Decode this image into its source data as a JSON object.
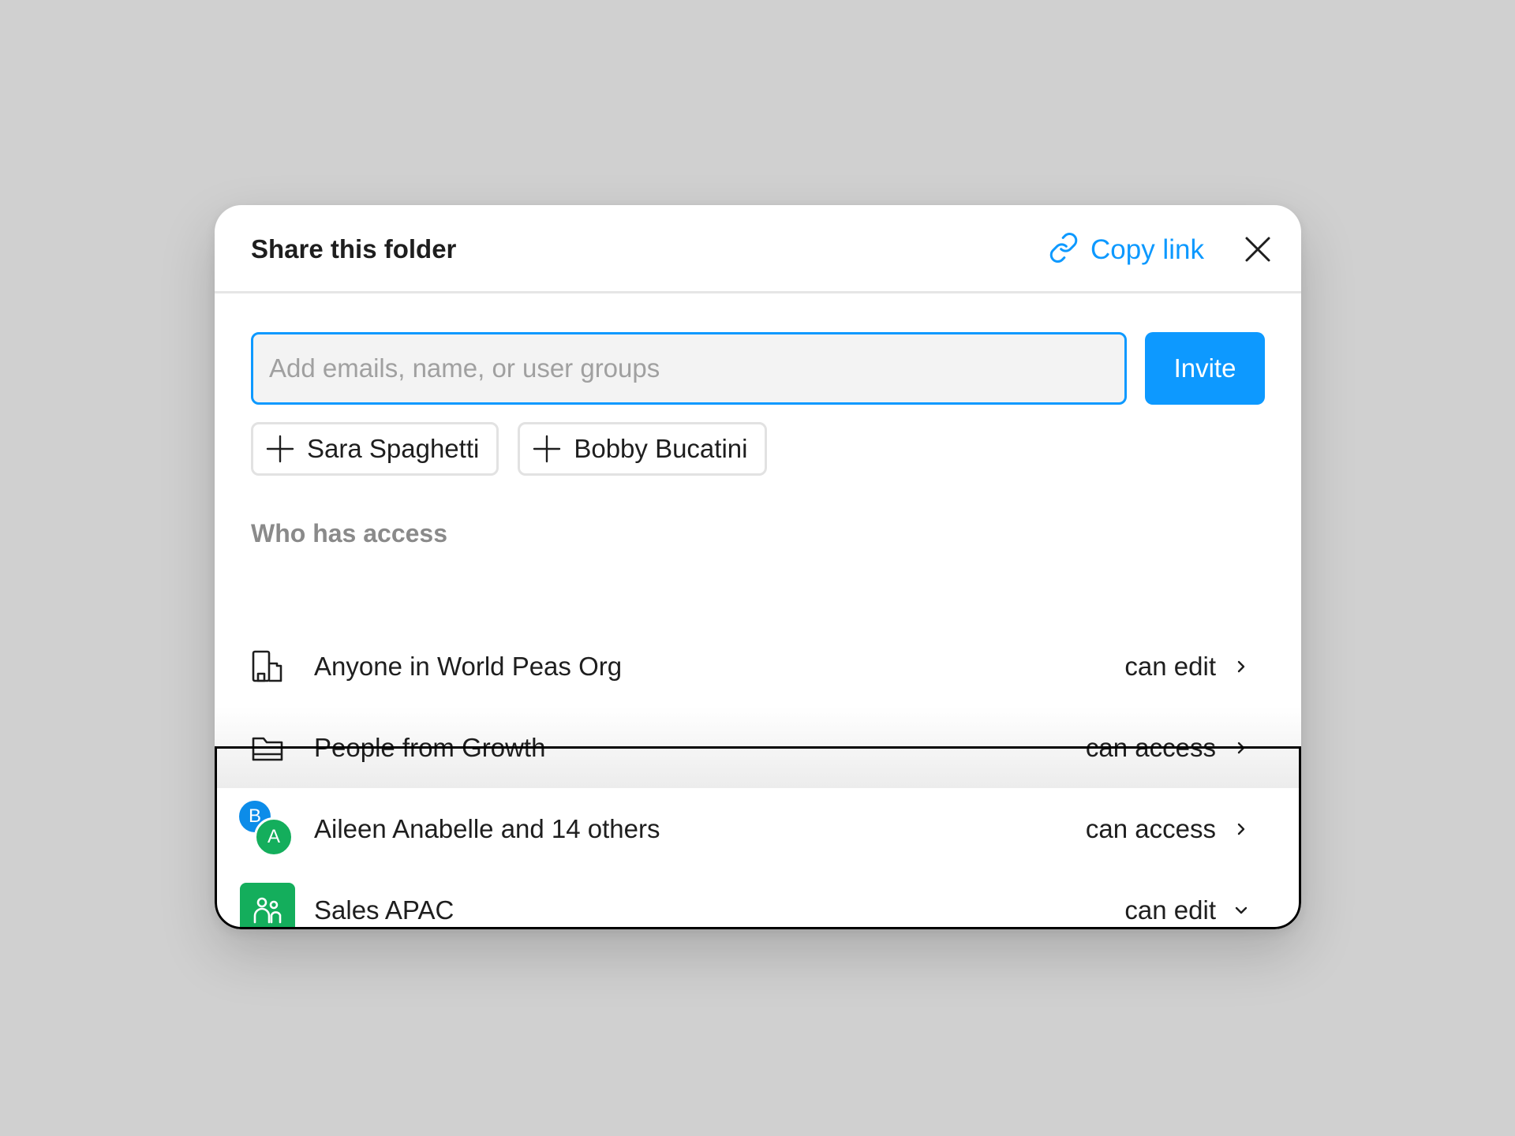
{
  "dialog": {
    "title": "Share this folder",
    "copy_link_label": "Copy link",
    "icons": {
      "copy_link": "link-icon",
      "close": "close-icon"
    }
  },
  "invite": {
    "placeholder": "Add emails, name, or user groups",
    "value": "",
    "button_label": "Invite"
  },
  "suggestions": [
    {
      "label": "Sara Spaghetti",
      "icon": "plus-icon"
    },
    {
      "label": "Bobby Bucatini",
      "icon": "plus-icon"
    }
  ],
  "access": {
    "section_label": "Who has access",
    "rows": [
      {
        "name": "Anyone in World Peas Org",
        "permission": "can edit",
        "icon": "organization-icon",
        "chevron": "chevron-right-icon"
      },
      {
        "name": "People from Growth",
        "permission": "can access",
        "icon": "folder-icon",
        "chevron": "chevron-right-icon"
      },
      {
        "name": "Aileen Anabelle and 14 others",
        "permission": "can access",
        "icon": "avatar-stack",
        "avatars": [
          "B",
          "A"
        ],
        "chevron": "chevron-right-icon"
      },
      {
        "name": "Sales APAC",
        "permission": "can edit",
        "icon": "user-group-icon",
        "chevron": "chevron-down-icon"
      }
    ]
  },
  "colors": {
    "accent": "#0d99ff",
    "background": "#d0d0d0",
    "avatar_b": "#0c8ce9",
    "avatar_a": "#14ae5c",
    "group_tile": "#14ae5c",
    "muted_text": "#8a8a8a"
  }
}
